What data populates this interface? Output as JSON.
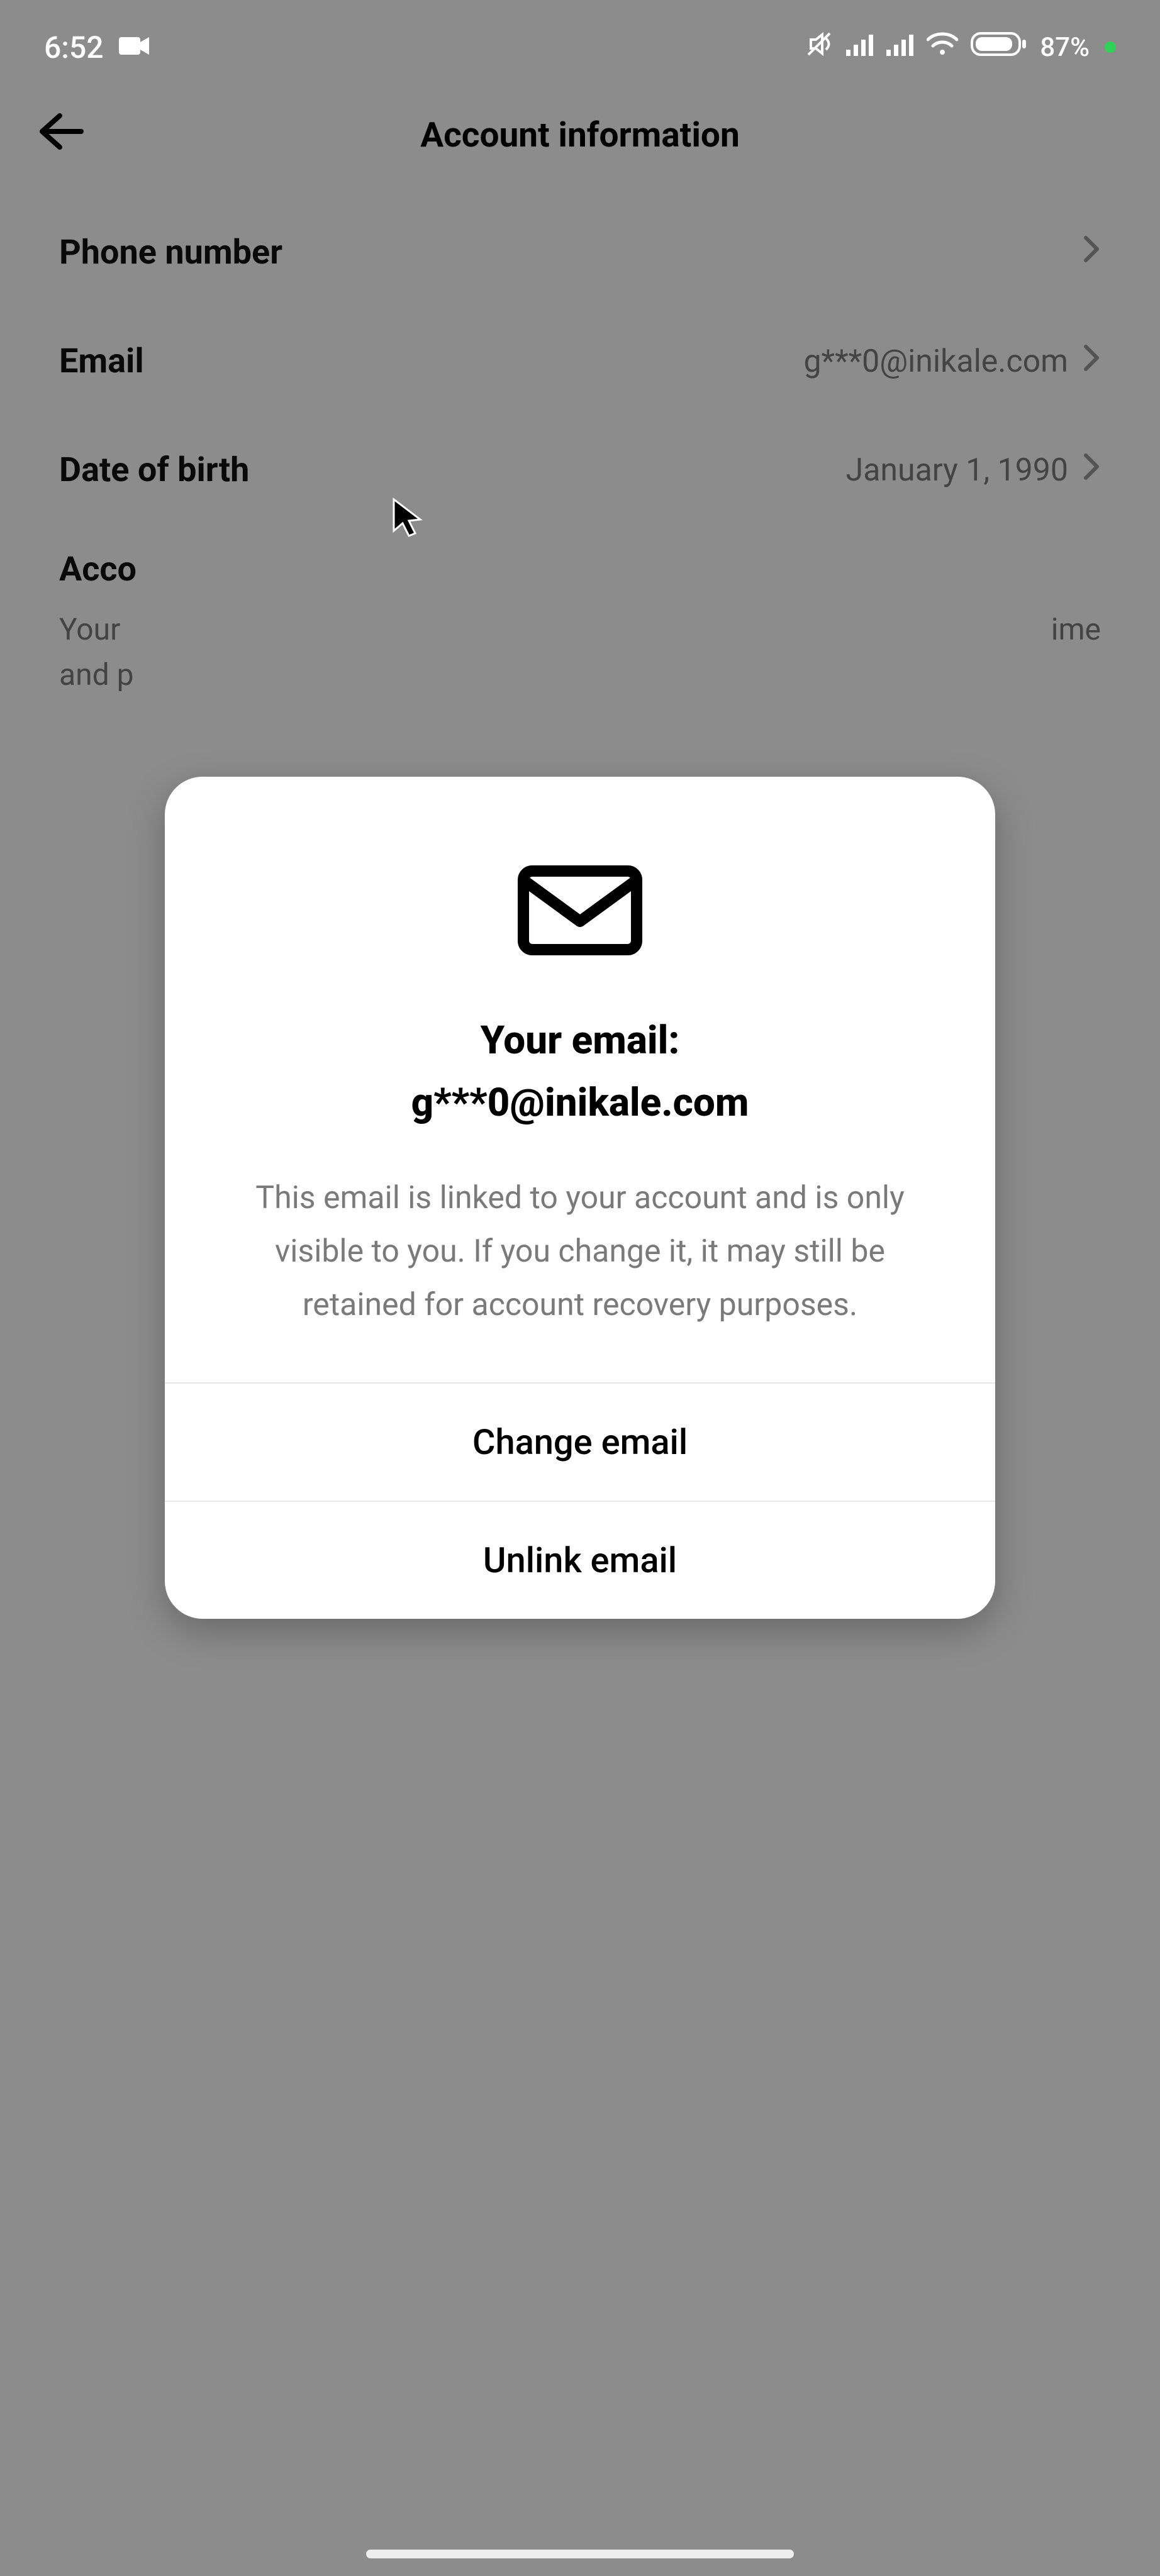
{
  "statusbar": {
    "time": "6:52",
    "battery": "87%"
  },
  "header": {
    "title": "Account information"
  },
  "list": {
    "phone": {
      "label": "Phone number",
      "value": ""
    },
    "email": {
      "label": "Email",
      "value": "g***0@inikale.com"
    },
    "dob": {
      "label": "Date of birth",
      "value": "January 1, 1990"
    }
  },
  "account_region": {
    "label": "Acco",
    "desc_line1": "Your",
    "desc_line2": "and p",
    "desc_right_fragment": "ime"
  },
  "modal": {
    "title_line1": "Your email:",
    "title_line2": "g***0@inikale.com",
    "description": "This email is linked to your account and is only visible to you. If you change it, it may still be retained for account recovery purposes.",
    "change_label": "Change email",
    "unlink_label": "Unlink email"
  }
}
